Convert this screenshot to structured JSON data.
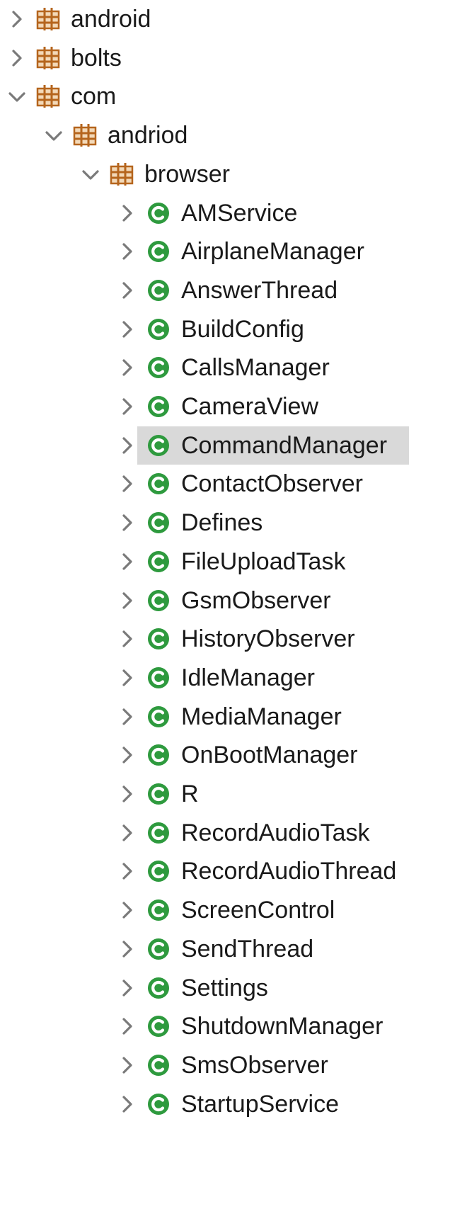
{
  "colors": {
    "package_icon": "#b5651d",
    "class_icon_fill": "#2e9a3e",
    "chevron": "#7a7a7a",
    "selection": "#d9d9d9"
  },
  "tree": {
    "items": [
      {
        "label": "android",
        "icon": "package-icon",
        "expanded": false,
        "level": 0
      },
      {
        "label": "bolts",
        "icon": "package-icon",
        "expanded": false,
        "level": 0
      },
      {
        "label": "com",
        "icon": "package-icon",
        "expanded": true,
        "level": 0
      },
      {
        "label": "andriod",
        "icon": "package-icon",
        "expanded": true,
        "level": 1
      },
      {
        "label": "browser",
        "icon": "package-icon",
        "expanded": true,
        "level": 2
      },
      {
        "label": "AMService",
        "icon": "class-icon",
        "expanded": false,
        "level": 3
      },
      {
        "label": "AirplaneManager",
        "icon": "class-icon",
        "expanded": false,
        "level": 3
      },
      {
        "label": "AnswerThread",
        "icon": "class-icon",
        "expanded": false,
        "level": 3
      },
      {
        "label": "BuildConfig",
        "icon": "class-icon",
        "expanded": false,
        "level": 3
      },
      {
        "label": "CallsManager",
        "icon": "class-icon",
        "expanded": false,
        "level": 3
      },
      {
        "label": "CameraView",
        "icon": "class-icon",
        "expanded": false,
        "level": 3
      },
      {
        "label": "CommandManager",
        "icon": "class-icon",
        "expanded": false,
        "level": 3,
        "selected": true
      },
      {
        "label": "ContactObserver",
        "icon": "class-icon",
        "expanded": false,
        "level": 3
      },
      {
        "label": "Defines",
        "icon": "class-icon",
        "expanded": false,
        "level": 3
      },
      {
        "label": "FileUploadTask",
        "icon": "class-icon",
        "expanded": false,
        "level": 3
      },
      {
        "label": "GsmObserver",
        "icon": "class-icon",
        "expanded": false,
        "level": 3
      },
      {
        "label": "HistoryObserver",
        "icon": "class-icon",
        "expanded": false,
        "level": 3
      },
      {
        "label": "IdleManager",
        "icon": "class-icon",
        "expanded": false,
        "level": 3
      },
      {
        "label": "MediaManager",
        "icon": "class-icon",
        "expanded": false,
        "level": 3
      },
      {
        "label": "OnBootManager",
        "icon": "class-icon",
        "expanded": false,
        "level": 3
      },
      {
        "label": "R",
        "icon": "class-icon",
        "expanded": false,
        "level": 3
      },
      {
        "label": "RecordAudioTask",
        "icon": "class-icon",
        "expanded": false,
        "level": 3
      },
      {
        "label": "RecordAudioThread",
        "icon": "class-icon",
        "expanded": false,
        "level": 3
      },
      {
        "label": "ScreenControl",
        "icon": "class-icon",
        "expanded": false,
        "level": 3
      },
      {
        "label": "SendThread",
        "icon": "class-icon",
        "expanded": false,
        "level": 3
      },
      {
        "label": "Settings",
        "icon": "class-icon",
        "expanded": false,
        "level": 3
      },
      {
        "label": "ShutdownManager",
        "icon": "class-icon",
        "expanded": false,
        "level": 3
      },
      {
        "label": "SmsObserver",
        "icon": "class-icon",
        "expanded": false,
        "level": 3
      },
      {
        "label": "StartupService",
        "icon": "class-icon",
        "expanded": false,
        "level": 3
      }
    ]
  }
}
